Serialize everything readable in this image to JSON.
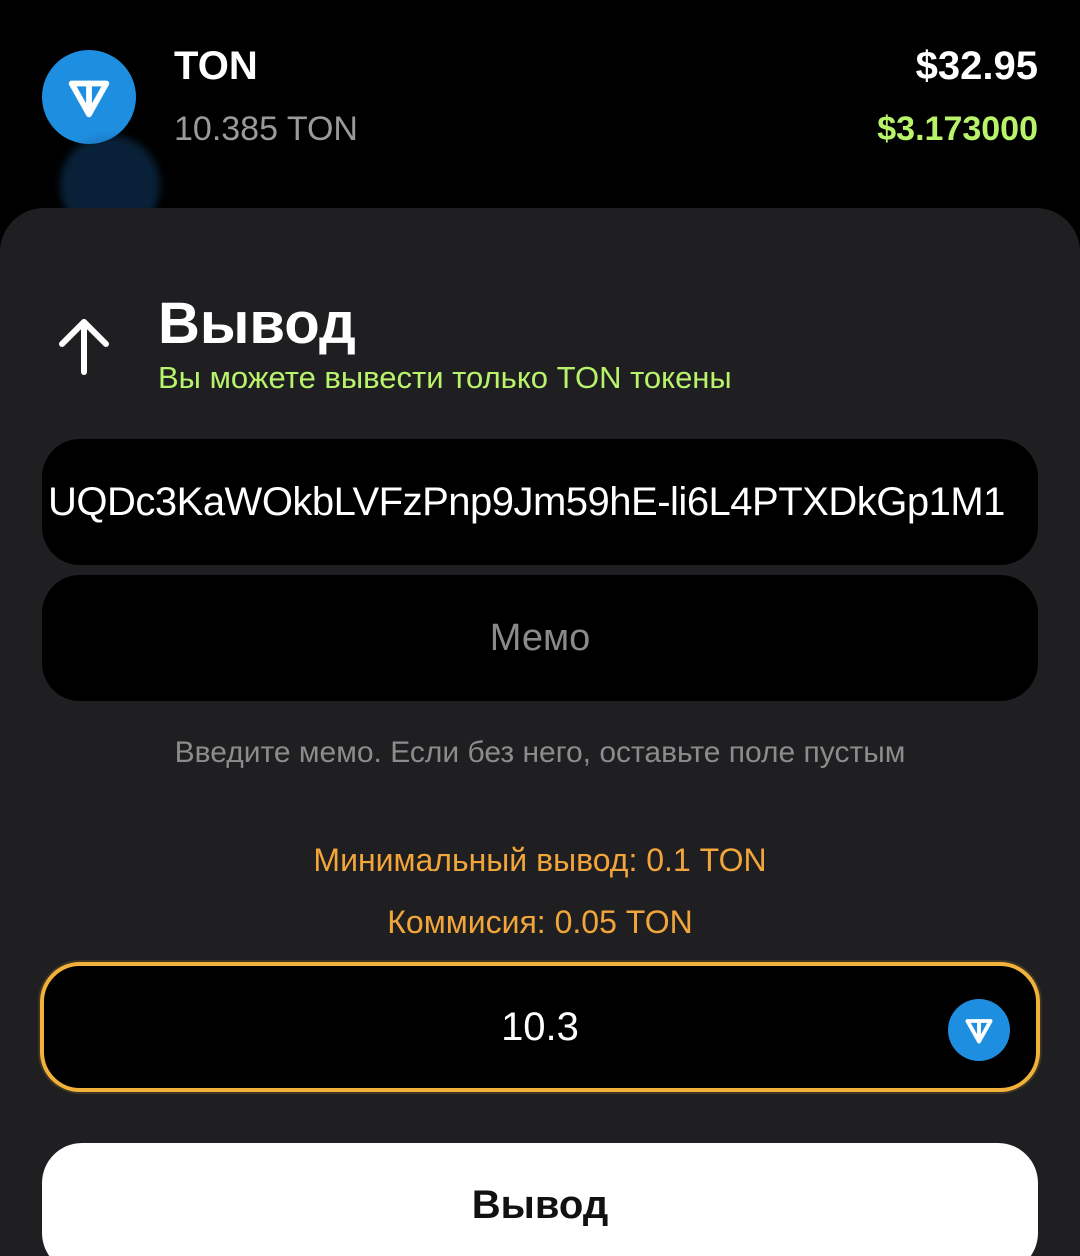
{
  "token_row": {
    "name": "TON",
    "amount": "10.385 TON",
    "usd_value": "$32.95",
    "price": "$3.173000",
    "logo_icon": "ton-logo-icon",
    "logo_color": "#1e8fe0"
  },
  "withdraw_sheet": {
    "title": "Вывод",
    "subtitle": "Вы можете вывести только TON токены",
    "address_value": "UQDc3KaWOkbLVFzPnp9Jm59hE-li6L4PTXDkGp1M1",
    "memo_placeholder": "Мемо",
    "memo_hint": "Введите мемо. Если без него, оставьте поле пустым",
    "min_withdraw": "Минимальный вывод: 0.1 TON",
    "fee": "Коммисия: 0.05 TON",
    "amount_value": "10.3",
    "submit_label": "Вывод"
  },
  "colors": {
    "accent_green": "#b8f36b",
    "accent_orange": "#f2a53a",
    "sheet_background": "#1f1f21",
    "ton_blue": "#1e8fe0"
  }
}
